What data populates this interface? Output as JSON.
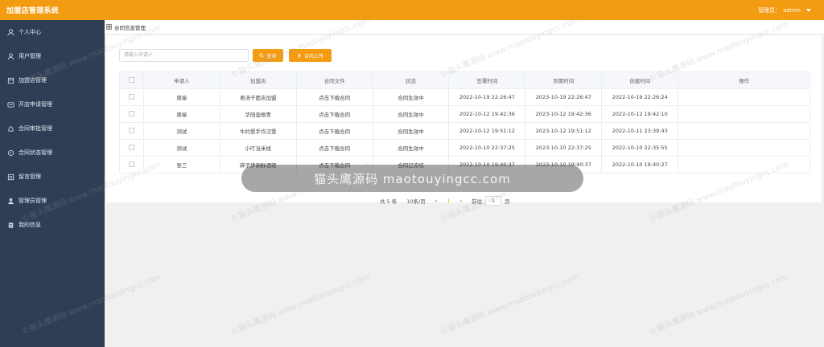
{
  "app": {
    "title": "加盟店管理系统",
    "admin_label": "管理员：",
    "admin_name": "admin"
  },
  "sidebar": {
    "items": [
      {
        "label": "个人中心",
        "icon": "person-icon"
      },
      {
        "label": "用户管理",
        "icon": "user-icon"
      },
      {
        "label": "加盟店管理",
        "icon": "store-icon"
      },
      {
        "label": "开店申请管理",
        "icon": "apply-icon"
      },
      {
        "label": "合同审批管理",
        "icon": "approve-icon"
      },
      {
        "label": "合同状态管理",
        "icon": "status-icon"
      },
      {
        "label": "留言管理",
        "icon": "message-icon"
      },
      {
        "label": "管理员管理",
        "icon": "admin-icon"
      },
      {
        "label": "我的信息",
        "icon": "info-icon"
      }
    ]
  },
  "breadcrumb": {
    "label": "合同信息管理"
  },
  "search": {
    "placeholder": "请输入申请人",
    "search_label": "查询",
    "upload_label": "合同上传"
  },
  "table": {
    "headers": [
      "申请人",
      "加盟店",
      "合同文件",
      "状态",
      "签署时间",
      "到期时间",
      "创建时间",
      "操作"
    ],
    "rows": [
      [
        "周瑜",
        "奥汤干面店加盟",
        "点击下载合同",
        "合同生效中",
        "2022-10-19 22:26:47",
        "2023-10-19 22:26:47",
        "2022-10-19 22:26:24",
        ""
      ],
      [
        "周瑜",
        "华阳壶根青",
        "点击下载合同",
        "合同生效中",
        "2022-10-12 19:42:36",
        "2023-10-12 19:42:36",
        "2022-10-12 19:42:10",
        ""
      ],
      [
        "测试",
        "牛约堡手作汉堡",
        "点击下载合同",
        "合同生效中",
        "2022-10-12 19:51:12",
        "2023-10-12 19:51:12",
        "2022-10-11 23:39:43",
        ""
      ],
      [
        "测试",
        "小叮当米线",
        "点击下载合同",
        "合同生效中",
        "2022-10-10 22:37:25",
        "2023-10-10 22:37:25",
        "2022-10-10 22:35:55",
        ""
      ],
      [
        "张三",
        "麻子步涮鲜酒馆",
        "点击下载合同",
        "合同已冻结",
        "2022-10-10 19:40:37",
        "2023-10-10 19:40:37",
        "2022-10-10 19:40:27",
        ""
      ]
    ]
  },
  "pagination": {
    "total": "共 5 条",
    "page_size": "10条/页",
    "current": "1",
    "goto_label": "前往",
    "goto_value": "1",
    "page_suffix": "页"
  },
  "toast": {
    "text": "猫头鹰源码 maotouyingcc.com"
  },
  "watermark": {
    "text": "©猫头鹰源码  www.maotouyingcc.com"
  },
  "colors": {
    "accent": "#f39c12",
    "sidebar_bg": "#2f3d55",
    "link": "#2a3a9a"
  }
}
